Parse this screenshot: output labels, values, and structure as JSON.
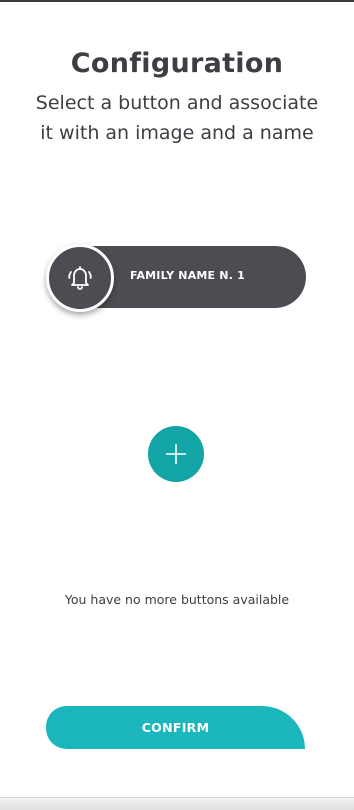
{
  "header": {
    "title": "Configuration",
    "subtitle_line1": "Select a button and associate",
    "subtitle_line2": "it with an image and a name"
  },
  "family_button": {
    "label": "FAMILY NAME N. 1",
    "icon": "bell-icon"
  },
  "add_button": {
    "icon": "plus-icon"
  },
  "status": {
    "message": "You have no more buttons available"
  },
  "footer": {
    "confirm_label": "CONFIRM"
  },
  "colors": {
    "pill": "#4e4c53",
    "accent_teal": "#13a4a5",
    "confirm_teal": "#1cb7bd",
    "text": "#3f3d43"
  }
}
